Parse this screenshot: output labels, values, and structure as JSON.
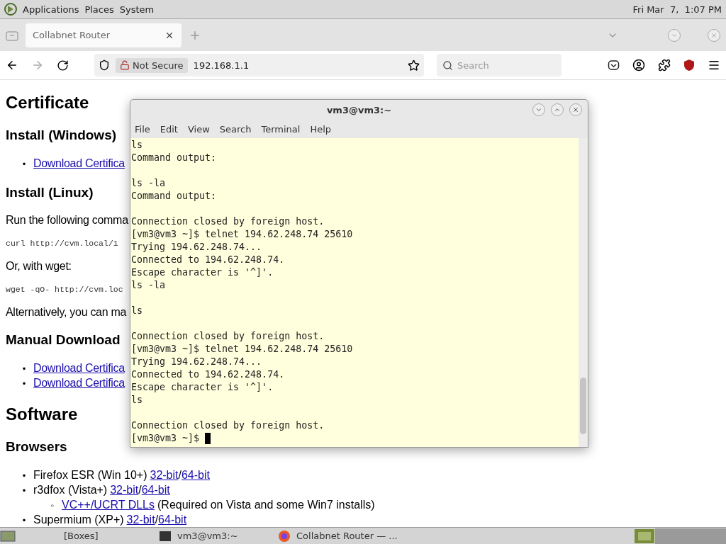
{
  "top_panel": {
    "menus": [
      "Applications",
      "Places",
      "System"
    ],
    "clock": "Fri Mar  7,  1:07 PM"
  },
  "browser": {
    "tabs": [
      {
        "label": "Collabnet Router",
        "selected": true
      }
    ],
    "address": {
      "security": "Not Secure",
      "url": "192.168.1.1"
    },
    "search": {
      "placeholder": "Search"
    }
  },
  "page": [
    {
      "kind": "h1",
      "text": "Certificate"
    },
    {
      "kind": "h2",
      "text": "Install (Windows)"
    },
    {
      "kind": "links",
      "items": [
        {
          "bullet": "•",
          "text": "Download Certifica"
        }
      ]
    },
    {
      "kind": "h2",
      "text": "Install (Linux)"
    },
    {
      "kind": "p",
      "text": "Run the following comma"
    },
    {
      "kind": "code",
      "text": "curl http://cvm.local/1"
    },
    {
      "kind": "p",
      "text": "Or, with wget:"
    },
    {
      "kind": "code",
      "text": "wget -qO- http://cvm.loc"
    },
    {
      "kind": "p",
      "text": "Alternatively, you can ma"
    },
    {
      "kind": "h2",
      "text": "Manual Download"
    },
    {
      "kind": "links",
      "items": [
        {
          "bullet": "•",
          "text": "Download Certifica"
        },
        {
          "bullet": "•",
          "text": "Download Certifica"
        }
      ]
    },
    {
      "kind": "h1",
      "text": "Software"
    },
    {
      "kind": "h2",
      "text": "Browsers"
    },
    {
      "kind": "software",
      "items": [
        {
          "bullet": "•",
          "name": "Firefox ESR (Win 10+)",
          "links": [
            "32-bit",
            "64-bit"
          ],
          "separator": "/"
        },
        {
          "bullet": "•",
          "name": "r3dfox (Vista+)",
          "links": [
            "32-bit",
            "64-bit"
          ],
          "separator": "/",
          "children": [
            {
              "bullet": "◦",
              "link": "VC++/UCRT DLLs",
              "note": "(Required on Vista and some Win7 installs)"
            }
          ]
        },
        {
          "bullet": "•",
          "name": "Supermium (XP+)",
          "links": [
            "32-bit",
            "64-bit"
          ],
          "separator": "/"
        }
      ]
    }
  ],
  "terminal": {
    "title": "vm3@vm3:~",
    "menus": [
      "File",
      "Edit",
      "View",
      "Search",
      "Terminal",
      "Help"
    ],
    "lines": [
      {
        "kind": "text",
        "text": "ls"
      },
      {
        "kind": "text",
        "text": "Command output:"
      },
      {
        "kind": "blank"
      },
      {
        "kind": "text",
        "text": "ls -la"
      },
      {
        "kind": "text",
        "text": "Command output:"
      },
      {
        "kind": "blank"
      },
      {
        "kind": "text",
        "text": "Connection closed by foreign host."
      },
      {
        "kind": "text",
        "text": "[vm3@vm3 ~]$ telnet 194.62.248.74 25610"
      },
      {
        "kind": "text",
        "text": "Trying 194.62.248.74..."
      },
      {
        "kind": "text",
        "text": "Connected to 194.62.248.74."
      },
      {
        "kind": "text",
        "text": "Escape character is '^]'."
      },
      {
        "kind": "text",
        "text": "ls -la"
      },
      {
        "kind": "blank"
      },
      {
        "kind": "text",
        "text": "ls"
      },
      {
        "kind": "blank"
      },
      {
        "kind": "text",
        "text": "Connection closed by foreign host."
      },
      {
        "kind": "text",
        "text": "[vm3@vm3 ~]$ telnet 194.62.248.74 25610"
      },
      {
        "kind": "text",
        "text": "Trying 194.62.248.74..."
      },
      {
        "kind": "text",
        "text": "Connected to 194.62.248.74."
      },
      {
        "kind": "text",
        "text": "Escape character is '^]'."
      },
      {
        "kind": "text",
        "text": "ls"
      },
      {
        "kind": "blank"
      },
      {
        "kind": "text",
        "text": "Connection closed by foreign host."
      },
      {
        "kind": "text",
        "text": "[vm3@vm3 ~]$ ",
        "cursor": true
      }
    ]
  },
  "taskbar": {
    "items": [
      {
        "label": "[Boxes]"
      },
      {
        "label": "vm3@vm3:~"
      },
      {
        "label": "Collabnet Router — ..."
      }
    ]
  }
}
